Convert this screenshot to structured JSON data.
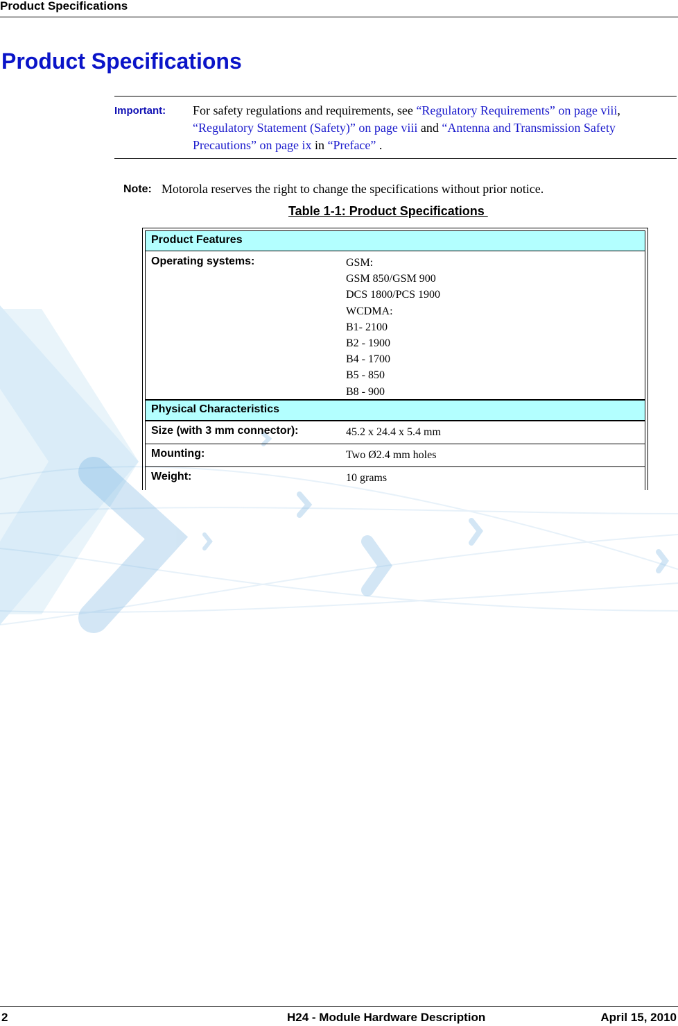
{
  "running_header": "Product Specifications",
  "page_title": "Product Specifications",
  "important": {
    "label": "Important:",
    "text_before": "For safety regulations and requirements, see ",
    "link1": "“Regulatory Requirements” on page viii",
    "sep1": ", ",
    "link2": "“Regulatory Statement (Safety)” on page viii",
    "sep2": " and ",
    "link3": "“Antenna and Transmission Safety Precautions” on page ix",
    "sep3": " in ",
    "link4": "“Preface”",
    "text_after": " ."
  },
  "note": {
    "label": "Note:",
    "text": "Motorola reserves the right to change the specifications without prior notice."
  },
  "table": {
    "title": "Table 1-1: Product Specifications ",
    "sections": [
      {
        "heading": "Product Features",
        "rows": [
          {
            "label": "Operating systems:",
            "values": [
              "GSM:",
              "GSM 850/GSM 900",
              "DCS 1800/PCS 1900",
              "WCDMA:",
              "B1- 2100",
              "B2 - 1900",
              "B4 - 1700",
              "B5 - 850",
              "B8 - 900"
            ]
          }
        ]
      },
      {
        "heading": "Physical Characteristics",
        "rows": [
          {
            "label": "Size (with 3 mm connector):",
            "value": "45.2 x 24.4 x 5.4 mm"
          },
          {
            "label": "Mounting:",
            "value": "Two Ø2.4 mm holes"
          },
          {
            "label": "Weight:",
            "value": "10 grams"
          }
        ]
      }
    ]
  },
  "footer": {
    "page_number": "2",
    "document_title": "H24 - Module Hardware Description",
    "date": "April 15, 2010"
  },
  "colors": {
    "title_blue": "#0a14c8",
    "link_blue": "#1a1acc",
    "table_section_fill": "#b3ffff",
    "watermark_blue": "#5aaee0"
  }
}
